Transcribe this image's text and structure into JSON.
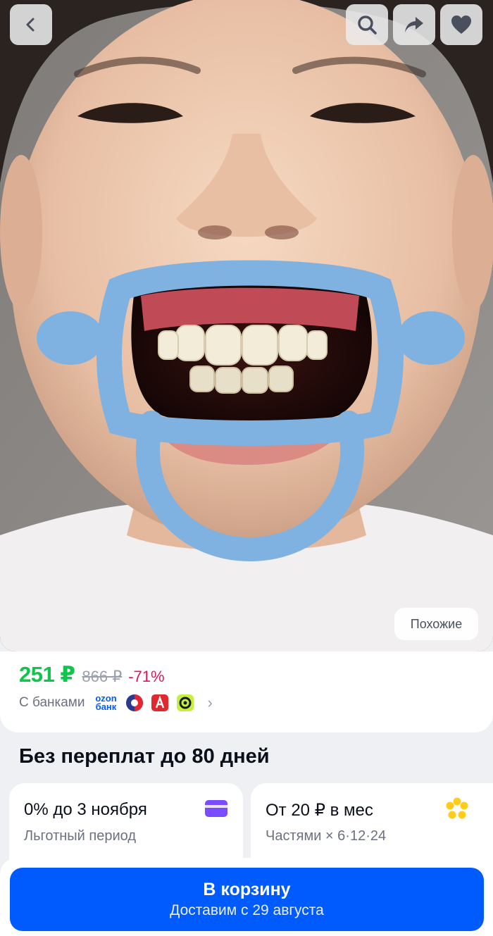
{
  "photo": {
    "subject": "child wearing a blue dental cheek retractor",
    "retractor_color": "#7fb2e0",
    "similar_label": "Похожие"
  },
  "top_bar": {
    "icons": [
      "back-arrow-icon",
      "search-icon",
      "share-icon",
      "heart-icon"
    ]
  },
  "price": {
    "current": "251 ₽",
    "old": "866 ₽",
    "discount": "-71%",
    "current_color": "#10c44c",
    "discount_color": "#e3145d"
  },
  "banks": {
    "label": "С банками",
    "ozon_logo_line1": "ozon",
    "ozon_logo_line2": "банк",
    "icons": [
      "ozon-bank-logo-icon",
      "bank-red-blue-icon",
      "bank-red-square-icon",
      "bank-green-icon",
      "chevron-right-icon"
    ]
  },
  "installments": {
    "title": "Без переплат до 80 дней",
    "cards": [
      {
        "title": "0% до 3 ноября",
        "subtitle": "Льготный период",
        "icon": "card-purple-icon"
      },
      {
        "title": "От 20 ₽ в мес",
        "subtitle": "Частями × 6·12·24",
        "icon": "yellow-flower-icon"
      }
    ]
  },
  "cart": {
    "button_label": "В корзину",
    "delivery_label": "Доставим с 29 августа",
    "accent": "#005bff"
  }
}
